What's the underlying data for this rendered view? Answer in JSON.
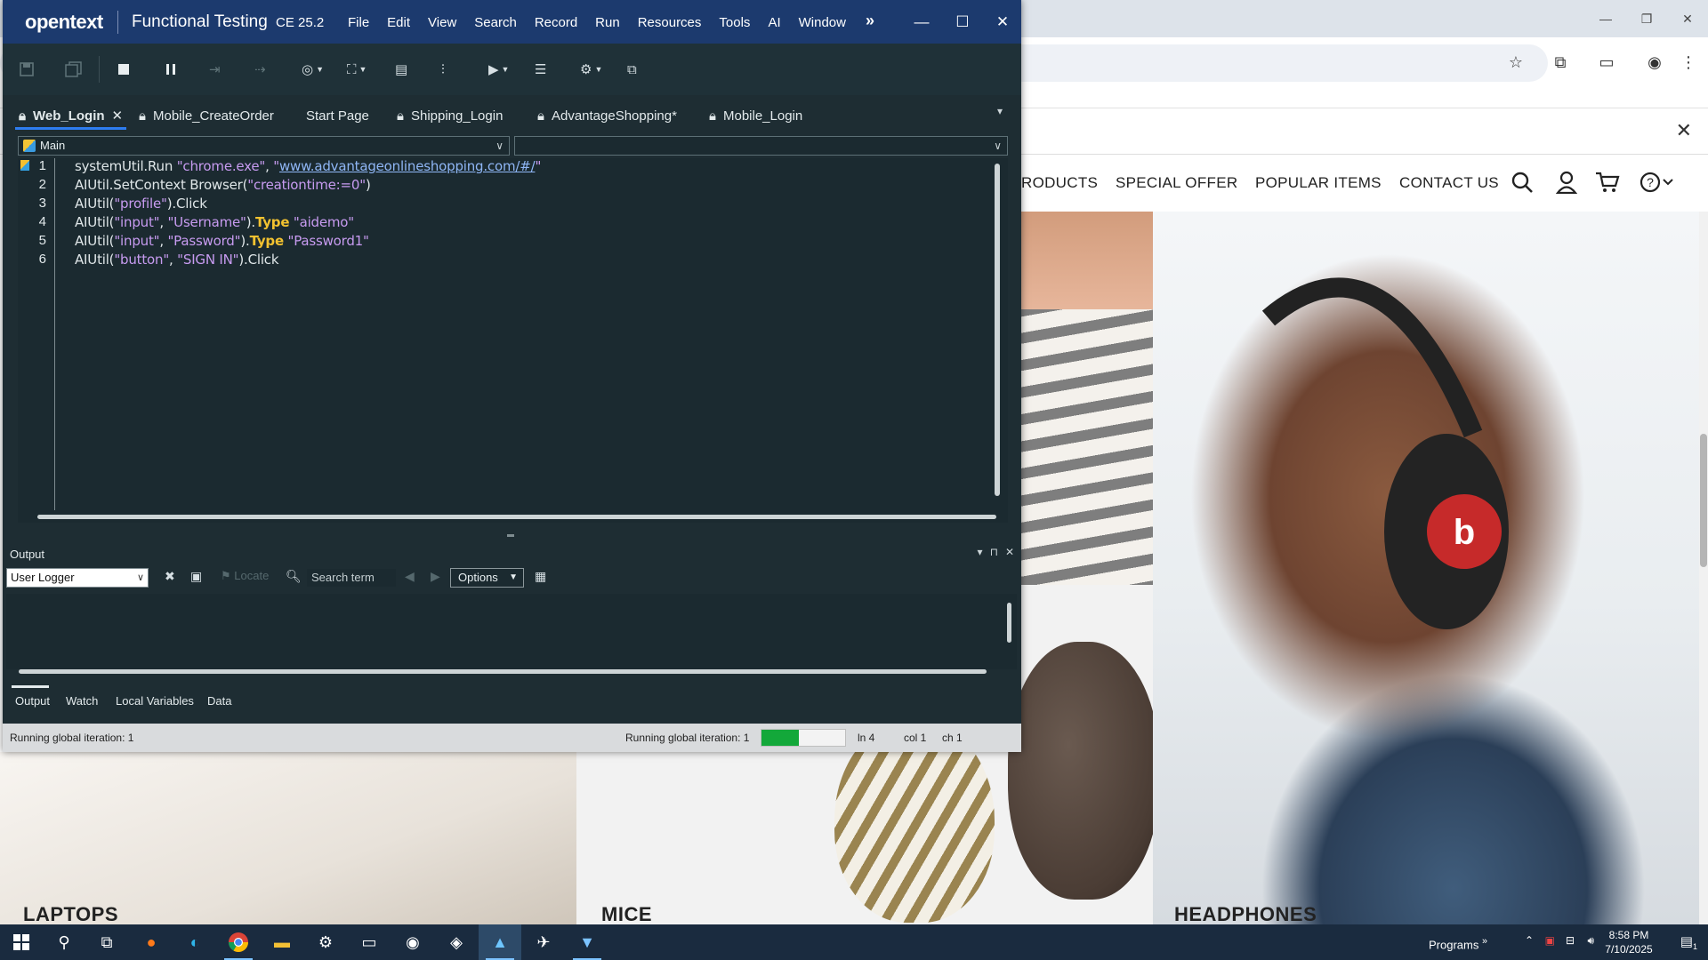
{
  "uft": {
    "logo": "opentext",
    "app_title": "Functional Testing",
    "edition": "CE 25.2",
    "menu": [
      "File",
      "Edit",
      "View",
      "Search",
      "Record",
      "Run",
      "Resources",
      "Tools",
      "AI",
      "Window"
    ],
    "tabs": [
      {
        "label": "Web_Login",
        "locked": true,
        "active": true,
        "closable": true
      },
      {
        "label": "Mobile_CreateOrder",
        "locked": true
      },
      {
        "label": "Start Page",
        "locked": false
      },
      {
        "label": "Shipping_Login",
        "locked": true
      },
      {
        "label": "AdvantageShopping*",
        "locked": true
      },
      {
        "label": "Mobile_Login",
        "locked": true
      }
    ],
    "scope": {
      "action": "Main",
      "secondary": ""
    },
    "code": {
      "line_numbers": [
        "1",
        "2",
        "3",
        "4",
        "5",
        "6"
      ],
      "current_line": 1,
      "lines": [
        [
          {
            "t": "systemUtil.Run "
          },
          {
            "t": "\"chrome.exe\"",
            "c": "str"
          },
          {
            "t": ", "
          },
          {
            "t": "\"",
            "c": "str"
          },
          {
            "t": "www.advantageonlineshopping.com/#/",
            "c": "lnk"
          },
          {
            "t": "\"",
            "c": "str"
          }
        ],
        [
          {
            "t": "AIUtil.SetContext Browser("
          },
          {
            "t": "\"creationtime:=0\"",
            "c": "str"
          },
          {
            "t": ")"
          }
        ],
        [
          {
            "t": "AIUtil("
          },
          {
            "t": "\"profile\"",
            "c": "str"
          },
          {
            "t": ").Click"
          }
        ],
        [
          {
            "t": "AIUtil("
          },
          {
            "t": "\"input\"",
            "c": "str"
          },
          {
            "t": ", "
          },
          {
            "t": "\"Username\"",
            "c": "str"
          },
          {
            "t": ")."
          },
          {
            "t": "Type",
            "c": "kw"
          },
          {
            "t": " "
          },
          {
            "t": "\"aidemo\"",
            "c": "str"
          }
        ],
        [
          {
            "t": "AIUtil("
          },
          {
            "t": "\"input\"",
            "c": "str"
          },
          {
            "t": ", "
          },
          {
            "t": "\"Password\"",
            "c": "str"
          },
          {
            "t": ")."
          },
          {
            "t": "Type",
            "c": "kw"
          },
          {
            "t": " "
          },
          {
            "t": "\"Password1\"",
            "c": "str"
          }
        ],
        [
          {
            "t": "AIUtil("
          },
          {
            "t": "\"button\"",
            "c": "str"
          },
          {
            "t": ", "
          },
          {
            "t": "\"SIGN IN\"",
            "c": "str"
          },
          {
            "t": ").Click"
          }
        ]
      ]
    },
    "output": {
      "title": "Output",
      "logger": "User Logger",
      "locate_label": "Locate",
      "search_placeholder": "Search term",
      "options_label": "Options",
      "tabs": [
        "Output",
        "Watch",
        "Local Variables",
        "Data"
      ]
    },
    "status": {
      "left": "Running global iteration: 1",
      "right": "Running global iteration: 1",
      "progress_fraction": 0.45,
      "line": "ln 4",
      "col": "col 1",
      "ch": "ch 1"
    },
    "colors": {
      "titlebar": "#1c3a6e",
      "editor_bg": "#1b2a30",
      "string": "#c79bf0",
      "keyword": "#f2c230",
      "progress": "#13a83a"
    }
  },
  "site": {
    "nav": [
      "RODUCTS",
      "SPECIAL OFFER",
      "POPULAR ITEMS",
      "CONTACT US"
    ],
    "icons": [
      "search-icon",
      "user-icon",
      "cart-icon",
      "help-icon"
    ],
    "tiles": [
      "LAPTOPS",
      "MICE",
      "HEADPHONES"
    ]
  },
  "taskbar": {
    "programs_label": "Programs",
    "time": "8:58 PM",
    "date": "7/10/2025",
    "notification_count": "1"
  }
}
